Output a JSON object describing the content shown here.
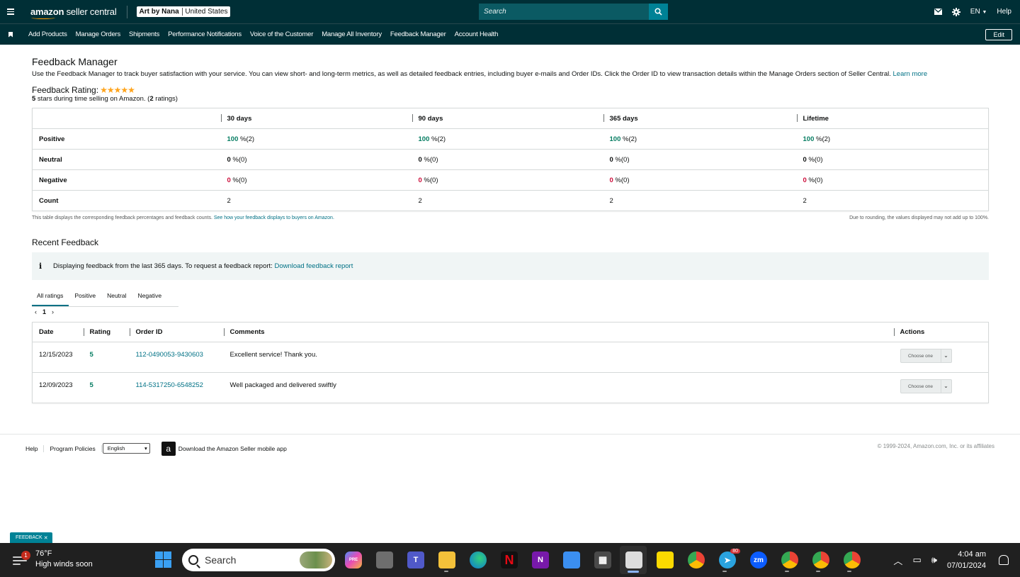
{
  "header": {
    "logo_brand": "amazon",
    "logo_product": " seller central",
    "store_name": "Art by Nana",
    "marketplace": "United States",
    "search_placeholder": "Search",
    "language": "EN",
    "help": "Help"
  },
  "nav": {
    "items": [
      "Add Products",
      "Manage Orders",
      "Shipments",
      "Performance Notifications",
      "Voice of the Customer",
      "Manage All Inventory",
      "Feedback Manager",
      "Account Health"
    ],
    "edit": "Edit"
  },
  "page": {
    "title": "Feedback Manager",
    "intro": "Use the Feedback Manager to track buyer satisfaction with your service. You can view short- and long-term metrics, as well as detailed feedback entries, including buyer e-mails and Order IDs. Click the Order ID to view transaction details within the Manage Orders section of Seller Central.",
    "learn_more": "Learn more",
    "rating_label": "Feedback Rating:",
    "rating_stars": "★★★★★",
    "rating_value": "5",
    "rating_sub_text": " stars during time selling on Amazon. (",
    "rating_count": "2",
    "rating_sub_end": " ratings)"
  },
  "summary_table": {
    "columns": [
      "30 days",
      "90 days",
      "365 days",
      "Lifetime"
    ],
    "rows": [
      {
        "label": "Positive",
        "cells": [
          {
            "pct": "100",
            "rest": " %(2)"
          },
          {
            "pct": "100",
            "rest": " %(2)"
          },
          {
            "pct": "100",
            "rest": " %(2)"
          },
          {
            "pct": "100",
            "rest": " %(2)"
          }
        ]
      },
      {
        "label": "Neutral",
        "cells": [
          {
            "pct": "0",
            "rest": " %(0)"
          },
          {
            "pct": "0",
            "rest": " %(0)"
          },
          {
            "pct": "0",
            "rest": " %(0)"
          },
          {
            "pct": "0",
            "rest": " %(0)"
          }
        ]
      },
      {
        "label": "Negative",
        "cells": [
          {
            "pct": "0",
            "rest": " %(0)"
          },
          {
            "pct": "0",
            "rest": " %(0)"
          },
          {
            "pct": "0",
            "rest": " %(0)"
          },
          {
            "pct": "0",
            "rest": " %(0)"
          }
        ]
      },
      {
        "label": "Count",
        "cells": [
          {
            "pct": "",
            "rest": "2"
          },
          {
            "pct": "",
            "rest": "2"
          },
          {
            "pct": "",
            "rest": "2"
          },
          {
            "pct": "",
            "rest": "2"
          }
        ]
      }
    ],
    "note_left": "This table displays the corresponding feedback percentages and feedback counts.",
    "note_link": "See how your feedback displays to buyers on Amazon.",
    "note_right": "Due to rounding, the values displayed may not add up to 100%."
  },
  "recent": {
    "title": "Recent Feedback",
    "alert_text": "Displaying feedback from the last 365 days. To request a feedback report:",
    "alert_link": "Download feedback report",
    "tabs": [
      "All ratings",
      "Positive",
      "Neutral",
      "Negative"
    ],
    "page": "1",
    "columns": [
      "Date",
      "Rating",
      "Order ID",
      "Comments",
      "Actions"
    ],
    "rows": [
      {
        "date": "12/15/2023",
        "rating": "5",
        "order_id": "112-0490053-9430603",
        "comment": "Excellent service! Thank you.",
        "action": "Choose one"
      },
      {
        "date": "12/09/2023",
        "rating": "5",
        "order_id": "114-5317250-6548252",
        "comment": "Well packaged and delivered swiftly",
        "action": "Choose one"
      }
    ]
  },
  "footer": {
    "help": "Help",
    "policies": "Program Policies",
    "language": "English",
    "app_text": "Download the Amazon Seller mobile app",
    "copyright": "© 1999-2024, Amazon.com, Inc. or its affiliates"
  },
  "feedback_tab": "FEEDBACK",
  "taskbar": {
    "weather_badge": "1",
    "temp": "76°F",
    "weather_desc": "High winds soon",
    "search": "Search",
    "telegram_badge": "80",
    "time": "4:04 am",
    "date": "07/01/2024"
  }
}
